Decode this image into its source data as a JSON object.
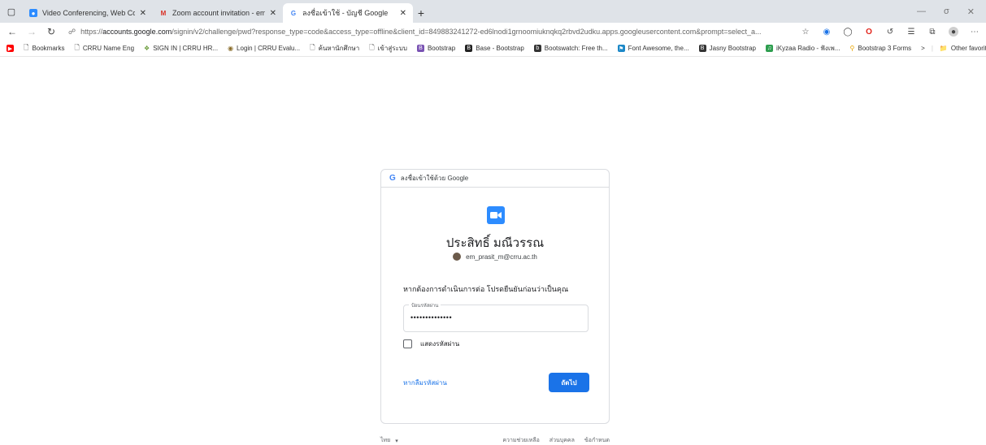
{
  "browser": {
    "tabs": [
      {
        "title": "Video Conferencing, Web Confe",
        "icon": "zoom-icon"
      },
      {
        "title": "Zoom account invitation - em_p",
        "icon": "gmail-icon"
      },
      {
        "title": "ลงชื่อเข้าใช้ - บัญชี Google",
        "icon": "google-icon"
      }
    ],
    "url_prefix": "https://",
    "url_host": "accounts.google.com",
    "url_rest": "/signin/v2/challenge/pwd?response_type=code&access_type=offline&client_id=849883241272-ed6lnodi1grnoomiuknqkq2rbvd2udku.apps.googleusercontent.com&prompt=select_a..."
  },
  "bookmarks": {
    "items": [
      {
        "label": "Bookmarks"
      },
      {
        "label": "CRRU Name Eng"
      },
      {
        "label": "SIGN IN | CRRU HR..."
      },
      {
        "label": "Login | CRRU Evalu..."
      },
      {
        "label": "ค้นหานักศึกษา"
      },
      {
        "label": "เข้าสู่ระบบ"
      },
      {
        "label": "Bootstrap"
      },
      {
        "label": "Base - Bootstrap"
      },
      {
        "label": "Bootswatch: Free th..."
      },
      {
        "label": "Font Awesome, the..."
      },
      {
        "label": "Jasny Bootstrap"
      },
      {
        "label": "iKyzaa Radio - ฟังเพ..."
      },
      {
        "label": "Bootstrap 3 Forms"
      }
    ],
    "other": "Other favorites"
  },
  "card": {
    "header": "ลงชื่อเข้าใช้ด้วย Google",
    "name": "ประสิทธิ์ มณีวรรณ",
    "email": "em_prasit_m@crru.ac.th",
    "prompt": "หากต้องการดำเนินการต่อ โปรดยืนยันก่อนว่าเป็นคุณ",
    "password_label": "ป้อนรหัสผ่าน",
    "password_value": "••••••••••••••",
    "show_password": "แสดงรหัสผ่าน",
    "forgot": "หากลืมรหัสผ่าน",
    "next": "ถัดไป"
  },
  "footer": {
    "language": "ไทย",
    "links": [
      "ความช่วยเหลือ",
      "ส่วนบุคคล",
      "ข้อกำหนด"
    ]
  }
}
